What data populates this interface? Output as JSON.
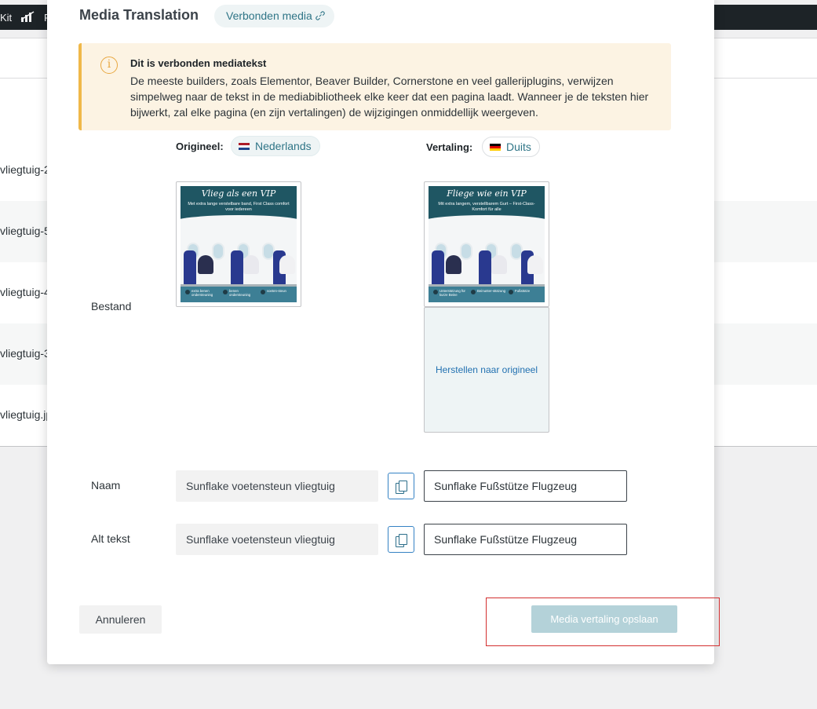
{
  "adminbar": {
    "kit_label": "Kit",
    "chart_icon": "chart-icon",
    "partial_label": "F"
  },
  "background_list": {
    "rows": [
      "vliegtuig-2",
      "vliegtuig-5",
      "vliegtuig-4",
      "vliegtuig-3",
      "vliegtuig.jp"
    ]
  },
  "modal": {
    "title": "Media Translation",
    "connected_chip": {
      "label": "Verbonden media",
      "icon": "link-icon"
    },
    "notice": {
      "icon": "info-icon",
      "title": "Dit is verbonden mediatekst",
      "body": "De meeste builders, zoals Elementor, Beaver Builder, Cornerstone en veel gallerijplugins, verwijzen simpelweg naar de tekst in de mediabibliotheek elke keer dat een pagina laadt. Wanneer je de teksten hier bijwerkt, zal elke pagina (en zijn vertalingen) de wijzigingen onmiddellijk weergeven."
    },
    "original": {
      "label": "Origineel:",
      "language": "Nederlands",
      "flag": "flag-nl"
    },
    "translation": {
      "label": "Vertaling:",
      "language": "Duits",
      "flag": "flag-de"
    },
    "file_row": {
      "label": "Bestand",
      "original_image": {
        "title": "Vlieg als een VIP",
        "subtitle": "Met extra lange verstelbare band, First Class comfort voor iedereen",
        "features": [
          "extra benen ondersteuning",
          "benen ondersteuning",
          "voeten-steun"
        ]
      },
      "translated_image": {
        "title": "Fliege wie ein VIP",
        "subtitle": "Mit extra langem, verstellbarem Gurt – First-Class-Komfort für alle",
        "features": [
          "Unterstützung für kurze Beine",
          "Beinunter-stützung",
          "Fußstütze"
        ]
      },
      "restore_label": "Herstellen naar origineel"
    },
    "name_row": {
      "label": "Naam",
      "original_value": "Sunflake voetensteun vliegtuig",
      "translated_value": "Sunflake Fußstütze Flugzeug",
      "copy_icon": "copy-icon"
    },
    "alt_row": {
      "label": "Alt tekst",
      "original_value": "Sunflake voetensteun vliegtuig",
      "translated_value": "Sunflake Fußstütze Flugzeug",
      "copy_icon": "copy-icon"
    },
    "cancel_label": "Annuleren",
    "save_label": "Media vertaling opslaan"
  },
  "colors": {
    "accent": "#2f7587",
    "notice_bg": "#fcf3e3",
    "notice_border": "#f0b849",
    "save_button_disabled": "#b4d2d9",
    "highlight": "#d32f2f"
  }
}
